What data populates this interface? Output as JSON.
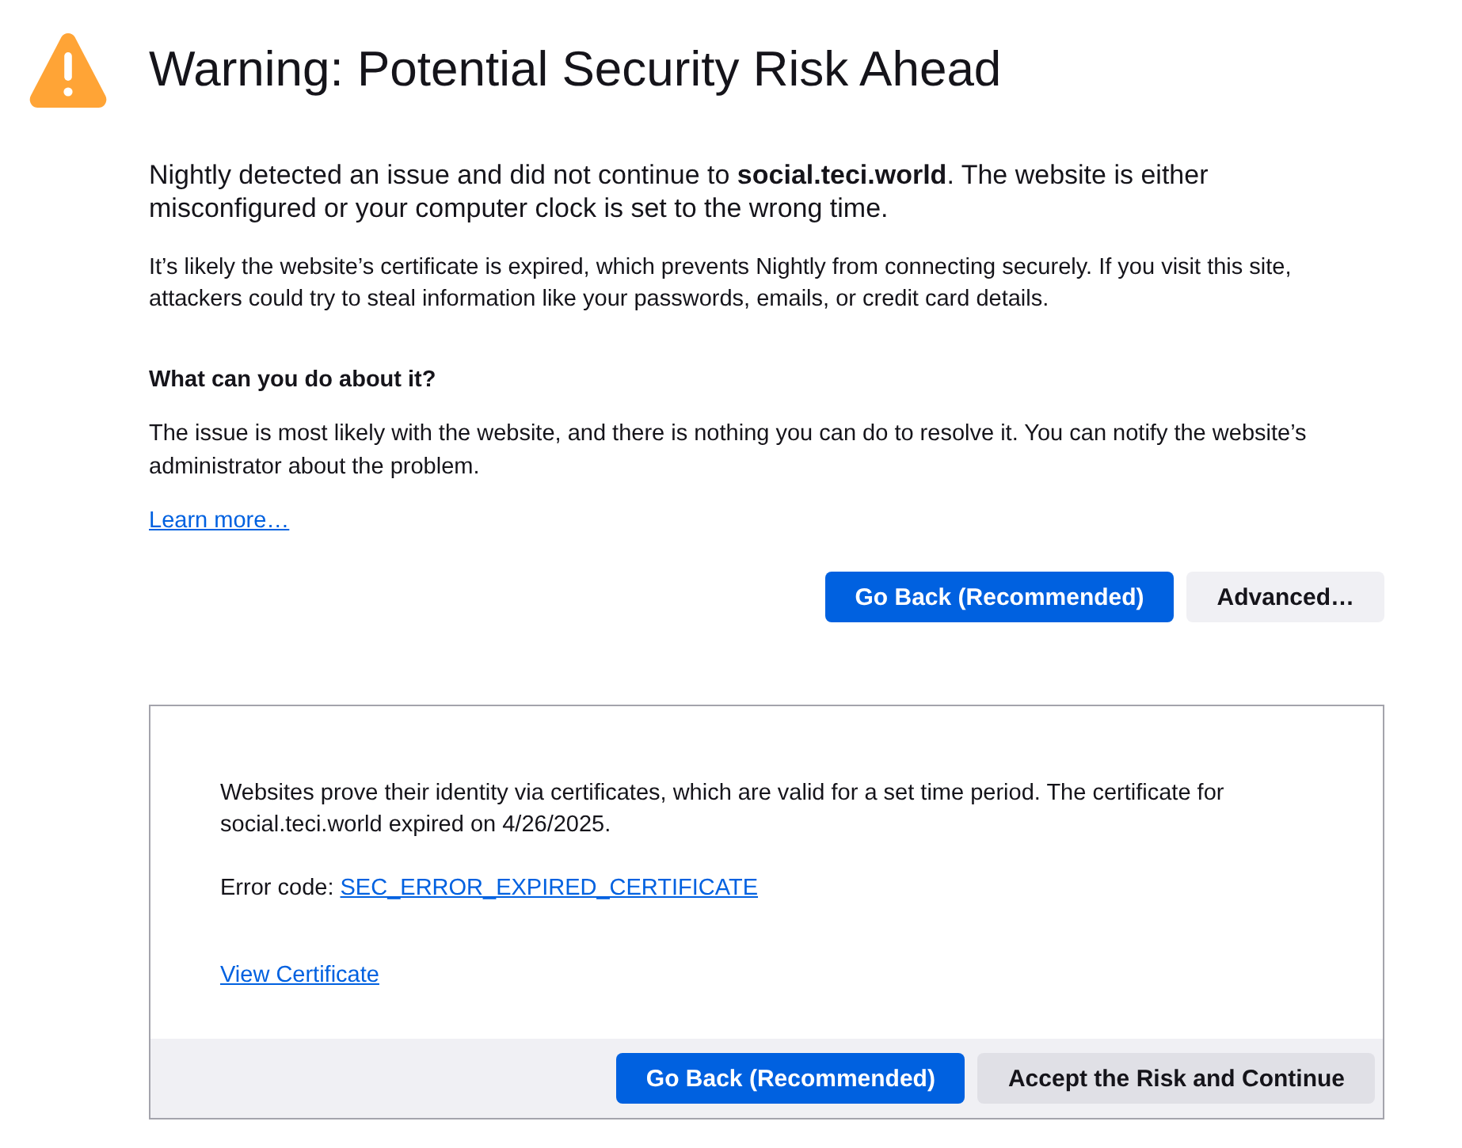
{
  "header": {
    "title": "Warning: Potential Security Risk Ahead"
  },
  "intro": "Nightly detected an issue and did not continue to **social.teci.world**. The website is either misconfigured or your computer clock is set to the wrong time.",
  "details": "It’s likely the website’s certificate is expired, which prevents Nightly from connecting securely. If you visit this site, attackers could try to steal information like your passwords, emails, or credit card details.",
  "help": {
    "heading": "What can you do about it?",
    "text": "The issue is most likely with the website, and there is nothing you can do to resolve it. You can notify the website’s administrator about the problem.",
    "link": "Learn more…"
  },
  "buttons": [
    {
      "label": "Go Back (Recommended)",
      "kind": "primary"
    },
    {
      "label": "Advanced…",
      "kind": "secondary"
    }
  ],
  "advanced_panel": {
    "expanded": true,
    "text": "Websites prove their identity via certificates, which are valid for a set time period. The certificate for social.teci.world expired on 4/26/2025.",
    "error_code_label": "Error code:",
    "error_code": "SEC_ERROR_EXPIRED_CERTIFICATE",
    "view_certificate": "View Certificate",
    "buttons": [
      {
        "label": "Go Back (Recommended)",
        "kind": "primary"
      },
      {
        "label": "Accept the Risk and Continue",
        "kind": "tertiary"
      }
    ]
  }
}
